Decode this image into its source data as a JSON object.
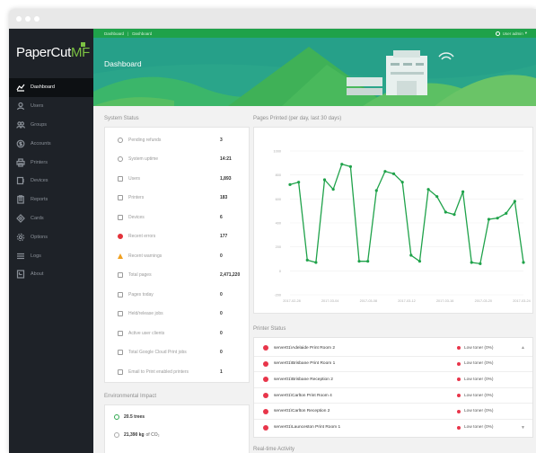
{
  "app": {
    "logo_main": "PaperCut",
    "logo_suffix": "MF"
  },
  "breadcrumb": {
    "root": "Dashboard",
    "current": "Dashboard"
  },
  "user": {
    "label": "User admin"
  },
  "page": {
    "title": "Dashboard"
  },
  "nav": [
    {
      "label": "Dashboard",
      "icon": "dashboard-icon"
    },
    {
      "label": "Users",
      "icon": "user-icon"
    },
    {
      "label": "Groups",
      "icon": "groups-icon"
    },
    {
      "label": "Accounts",
      "icon": "accounts-icon"
    },
    {
      "label": "Printers",
      "icon": "printer-icon"
    },
    {
      "label": "Devices",
      "icon": "device-icon"
    },
    {
      "label": "Reports",
      "icon": "reports-icon"
    },
    {
      "label": "Cards",
      "icon": "cards-icon"
    },
    {
      "label": "Options",
      "icon": "gear-icon"
    },
    {
      "label": "Logs",
      "icon": "logs-icon"
    },
    {
      "label": "About",
      "icon": "about-icon"
    }
  ],
  "system_status": {
    "title": "System Status",
    "rows": [
      {
        "label": "Pending refunds",
        "value": "3"
      },
      {
        "label": "System uptime",
        "value": "14:21"
      },
      {
        "label": "Users",
        "value": "1,893"
      },
      {
        "label": "Printers",
        "value": "183"
      },
      {
        "label": "Devices",
        "value": "6"
      },
      {
        "label": "Recent errors",
        "value": "177"
      },
      {
        "label": "Recent warnings",
        "value": "0"
      },
      {
        "label": "Total pages",
        "value": "2,471,220"
      },
      {
        "label": "Pages today",
        "value": "0"
      },
      {
        "label": "Held/release jobs",
        "value": "0"
      },
      {
        "label": "Active user clients",
        "value": "0"
      },
      {
        "label": "Total Google Cloud Print jobs",
        "value": "0"
      },
      {
        "label": "Email to Print enabled printers",
        "value": "1"
      }
    ]
  },
  "environmental": {
    "title": "Environmental Impact",
    "rows": [
      {
        "value": "20.5 trees",
        "label": ""
      },
      {
        "value": "21,390 kg",
        "label": "of CO₂"
      }
    ]
  },
  "chart_data": {
    "type": "line",
    "title": "Pages Printed (per day, last 30 days)",
    "color": "#1fa24a",
    "y_ticks": [
      "1000",
      "800",
      "600",
      "400",
      "200",
      "0",
      "-200"
    ],
    "ylim": [
      -200,
      1000
    ],
    "x_ticks": [
      "2017-02-28",
      "2017-03-04",
      "2017-03-08",
      "2017-03-12",
      "2017-03-16",
      "2017-03-20",
      "2017-03-24"
    ],
    "values": [
      720,
      740,
      90,
      70,
      760,
      680,
      890,
      870,
      80,
      80,
      670,
      830,
      810,
      740,
      130,
      80,
      680,
      620,
      490,
      470,
      660,
      70,
      60,
      430,
      440,
      480,
      580,
      70
    ]
  },
  "printer_status": {
    "title": "Printer Status",
    "rows": [
      {
        "name": "server01\\Adelaide Print Room 2",
        "status": "Low toner (0%)"
      },
      {
        "name": "server01\\Brisbane Print Room 1",
        "status": "Low toner (0%)"
      },
      {
        "name": "server01\\Brisbane Reception 2",
        "status": "Low toner (0%)"
      },
      {
        "name": "server01\\Carlton Print Room 4",
        "status": "Low toner (0%)"
      },
      {
        "name": "server01\\Carlton Reception 2",
        "status": "Low toner (0%)"
      },
      {
        "name": "server01\\Launceston Print Room 1",
        "status": "Low toner (0%)"
      }
    ]
  },
  "activity": {
    "title": "Real-time Activity"
  }
}
